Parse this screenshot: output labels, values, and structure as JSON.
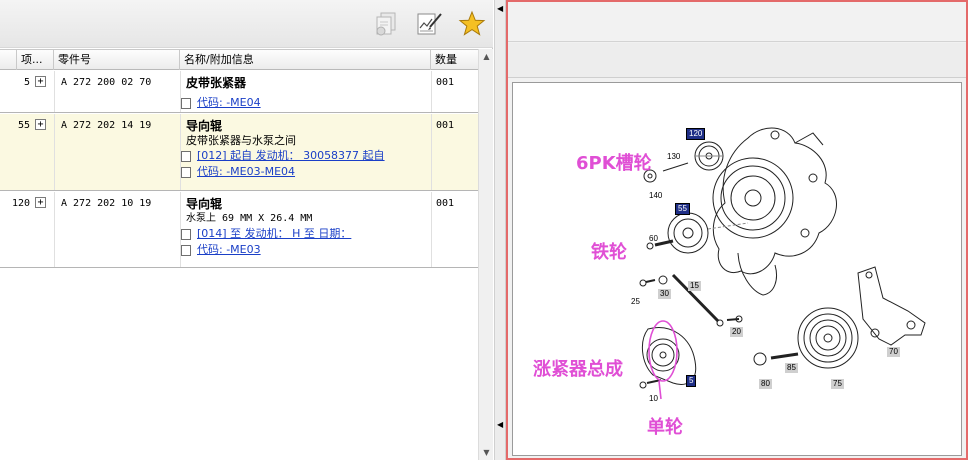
{
  "toolbar": {
    "icons": [
      "copy-document-icon",
      "edit-chart-icon",
      "favorite-star-icon"
    ]
  },
  "parts_table": {
    "columns": [
      "项...",
      "零件号",
      "名称/附加信息",
      "数量"
    ],
    "rows": [
      {
        "item": "5",
        "part_no": "A 272 200 02 70",
        "name": "皮带张紧器",
        "links": [
          "代码: -ME04"
        ],
        "qty": "001"
      },
      {
        "item": "55",
        "part_no": "A 272 202 14 19",
        "name": "导向辊",
        "note": "皮带张紧器与水泵之间",
        "links": [
          "[012] 起自 发动机： 30058377 起自",
          "代码: -ME03-ME04"
        ],
        "qty": "001"
      },
      {
        "item": "120",
        "part_no": "A 272 202 10 19",
        "name": "导向辊",
        "note": "水泵上 69 MM X 26.4 MM",
        "links": [
          "[014] 至 发动机： H 至 日期：",
          "代码: -ME03"
        ],
        "qty": "001"
      }
    ]
  },
  "diagram": {
    "callouts": [
      "120",
      "130",
      "140",
      "55",
      "60",
      "25",
      "30",
      "15",
      "20",
      "5",
      "10",
      "80",
      "85",
      "75",
      "70"
    ],
    "annotations": [
      "6PK槽轮",
      "铁轮",
      "涨紧器总成",
      "单轮"
    ],
    "colors": {
      "annotation": "#e04fd5",
      "selected_callout": "#1f2f87",
      "frame": "#e46a6a"
    }
  }
}
